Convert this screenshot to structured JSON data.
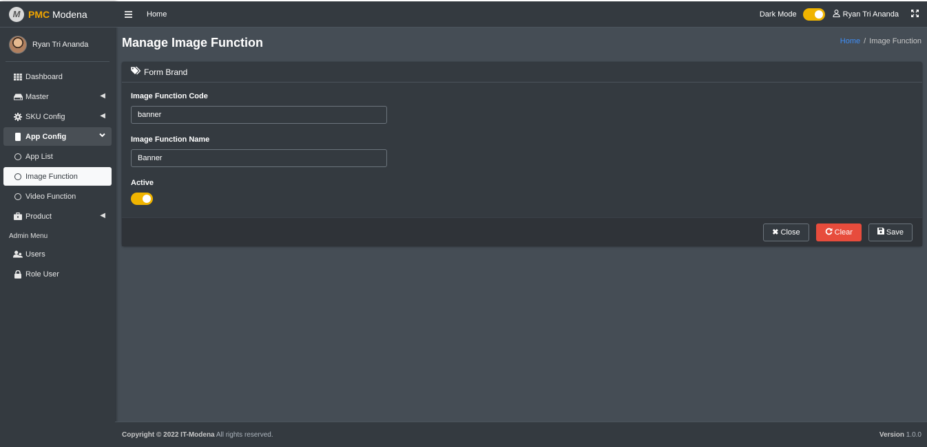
{
  "brand": {
    "logo_letter": "M",
    "accent": "PMC",
    "name": "Modena"
  },
  "user": {
    "name": "Ryan Tri Ananda"
  },
  "sidebar": {
    "items": [
      {
        "label": "Dashboard",
        "icon": "grid-icon"
      },
      {
        "label": "Master",
        "icon": "hdd-icon",
        "expandable": true
      },
      {
        "label": "SKU Config",
        "icon": "gear-icon",
        "expandable": true
      },
      {
        "label": "App Config",
        "icon": "mobile-icon",
        "expanded": true
      },
      {
        "label": "App List",
        "icon": "circle-icon"
      },
      {
        "label": "Image Function",
        "icon": "circle-icon",
        "active": true
      },
      {
        "label": "Video Function",
        "icon": "circle-icon"
      },
      {
        "label": "Product",
        "icon": "briefcase-icon",
        "expandable": true
      }
    ],
    "admin_header": "Admin Menu",
    "admin_items": [
      {
        "label": "Users",
        "icon": "users-icon"
      },
      {
        "label": "Role User",
        "icon": "lock-icon"
      }
    ]
  },
  "topnav": {
    "home": "Home",
    "dark_mode_label": "Dark Mode",
    "dark_mode_on": true,
    "user_name": "Ryan Tri Ananda"
  },
  "page": {
    "title": "Manage Image Function",
    "breadcrumb": {
      "home": "Home",
      "separator": "/",
      "current": "Image Function"
    }
  },
  "form": {
    "header": "Form Brand",
    "code_label": "Image Function Code",
    "code_value": "banner",
    "name_label": "Image Function Name",
    "name_value": "Banner",
    "active_label": "Active",
    "active_on": true,
    "buttons": {
      "close": "Close",
      "clear": "Clear",
      "save": "Save"
    }
  },
  "footer": {
    "copyright": "Copyright © 2022 IT-Modena",
    "rights": " All rights reserved.",
    "version_label": "Version",
    "version": " 1.0.0"
  },
  "colors": {
    "accent": "#f0b400",
    "danger": "#e74c3c",
    "link": "#3f8ef7",
    "sidebar": "#343a40",
    "content_bg": "#454d55"
  }
}
